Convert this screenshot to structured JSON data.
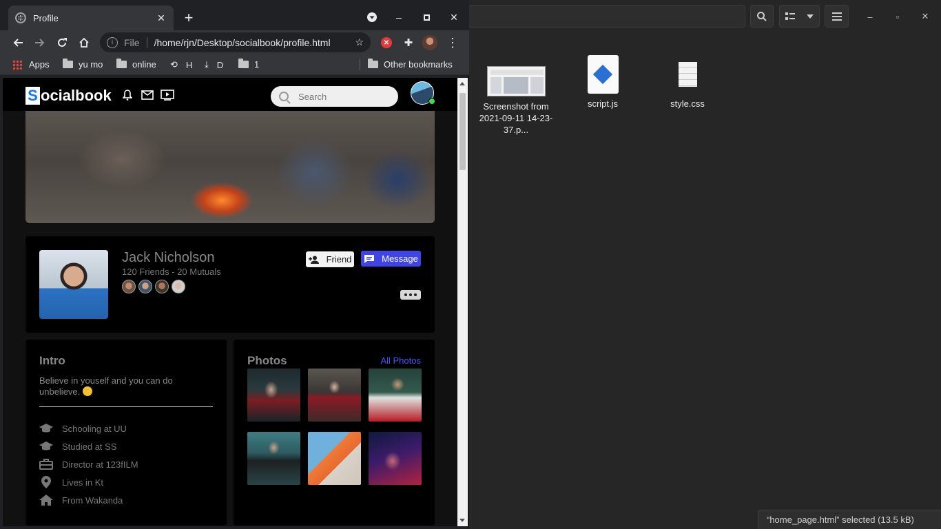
{
  "file_manager": {
    "files": [
      {
        "name": "Screenshot from 2021-09-11 14-23-37.p...",
        "icon": "image-thumbnail-icon"
      },
      {
        "name": "script.js",
        "icon": "javascript-file-icon"
      },
      {
        "name": "style.css",
        "icon": "text-file-icon"
      }
    ],
    "status": "“home_page.html” selected  (13.5 kB)"
  },
  "browser": {
    "tab_title": "Profile",
    "omnibox": {
      "scheme_label": "File",
      "url": "/home/rjn/Desktop/socialbook/profile.html"
    },
    "bookmarks": [
      {
        "label": "Apps",
        "icon": "apps-grid-icon"
      },
      {
        "label": "yu mo",
        "icon": "folder-icon"
      },
      {
        "label": "online",
        "icon": "folder-icon"
      },
      {
        "label": "H",
        "icon": "history-icon"
      },
      {
        "label": "D",
        "icon": "download-icon"
      },
      {
        "label": "1",
        "icon": "folder-icon"
      }
    ],
    "other_bookmarks": "Other bookmarks"
  },
  "page": {
    "logo_letter": "S",
    "logo_rest": "ocialbook",
    "search_placeholder": "Search",
    "profile": {
      "name": "Jack Nicholson",
      "friends": "120 Friends - 20 Mutuals",
      "friend_button": "Friend",
      "message_button": "Message"
    },
    "intro": {
      "title": "Intro",
      "quote": "Believe in youself and you can do unbelieve.",
      "items": [
        {
          "label": "Schooling at UU",
          "icon": "graduation-cap-icon"
        },
        {
          "label": "Studied at SS",
          "icon": "graduation-cap-icon"
        },
        {
          "label": "Director at 123fILM",
          "icon": "briefcase-icon"
        },
        {
          "label": "Lives in Kt",
          "icon": "location-pin-icon"
        },
        {
          "label": "From Wakanda",
          "icon": "home-icon"
        }
      ]
    },
    "photos": {
      "title": "Photos",
      "all_link": "All Photos"
    }
  },
  "colors": {
    "accent": "#3f44e6",
    "link": "#4c54ff",
    "online": "#41db51"
  }
}
